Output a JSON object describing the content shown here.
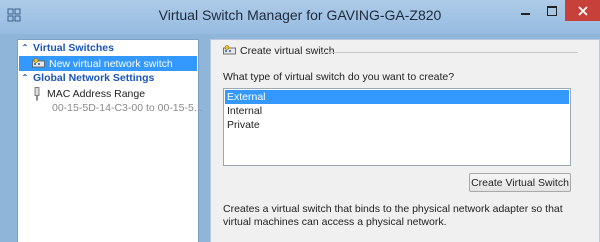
{
  "window": {
    "title": "Virtual Switch Manager for GAVING-GA-Z820",
    "controls": {
      "minimize": "minimize",
      "maximize": "maximize",
      "close": "✕"
    },
    "icon": "hyperv-app-icon"
  },
  "sidebar": {
    "sections": [
      {
        "label": "Virtual Switches",
        "items": [
          {
            "label": "New virtual network switch",
            "icon": "virtual-switch-icon",
            "selected": true
          }
        ]
      },
      {
        "label": "Global Network Settings",
        "items": [
          {
            "label": "MAC Address Range",
            "icon": "network-adapter-icon",
            "sublabel": "00-15-5D-14-C3-00 to 00-15-5..."
          }
        ]
      }
    ]
  },
  "main": {
    "group_title": "Create virtual switch",
    "group_icon": "virtual-switch-icon",
    "question": "What type of virtual switch do you want to create?",
    "options": [
      "External",
      "Internal",
      "Private"
    ],
    "selected_option": "External",
    "create_button": "Create Virtual Switch",
    "description_lines": [
      "Creates a virtual switch that binds to the physical network adapter so that",
      "virtual machines can access a physical network."
    ]
  },
  "colors": {
    "frame": "#8fb5d9",
    "section_header": "#1a56b8",
    "selection": "#3399ff",
    "close_button": "#c7403a"
  }
}
